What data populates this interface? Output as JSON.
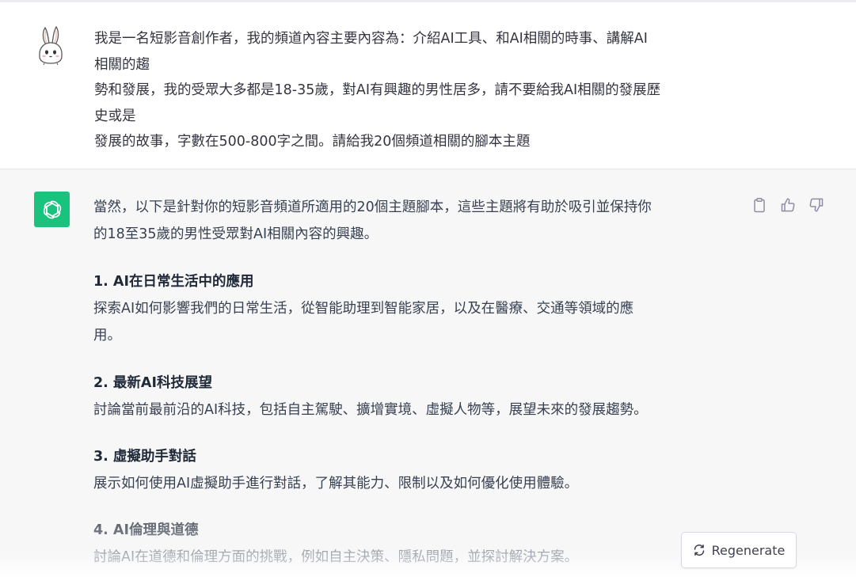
{
  "user": {
    "avatar_icon": "rabbit-avatar-icon",
    "lines": [
      "我是一名短影音創作者，我的頻道內容主要內容為：介紹AI工具、和AI相關的時事、講解AI",
      "相關的趨",
      "勢和發展，我的受眾大多都是18-35歲，對AI有興趣的男性居多，請不要給我AI相關的發展歷",
      "史或是",
      "發展的故事，字數在500-800字之間。請給我20個頻道相關的腳本主題"
    ]
  },
  "assistant": {
    "icon": "openai-logo-icon",
    "intro_lines": [
      "當然，以下是針對你的短影音頻道所適用的20個主題腳本，這些主題將有助於吸引並保持你",
      "的18至35歲的男性受眾對AI相關內容的興趣。"
    ],
    "topics": [
      {
        "title": "1. AI在日常生活中的應用",
        "lines": [
          "探索AI如何影響我們的日常生活，從智能助理到智能家居，以及在醫療、交通等領域的應",
          "用。"
        ]
      },
      {
        "title": "2. 最新AI科技展望",
        "lines": [
          "討論當前最前沿的AI科技，包括自主駕駛、擴增實境、虛擬人物等，展望未來的發展趨勢。"
        ]
      },
      {
        "title": "3. 虛擬助手對話",
        "lines": [
          "展示如何使用AI虛擬助手進行對話，了解其能力、限制以及如何優化使用體驗。"
        ]
      },
      {
        "title": "4. AI倫理與道德",
        "lines": [
          "討論AI在道德和倫理方面的挑戰，例如自主決策、隱私問題，並探討解決方案。"
        ]
      }
    ]
  },
  "actions": {
    "copy_icon": "clipboard-icon",
    "like_icon": "thumbs-up-icon",
    "dislike_icon": "thumbs-down-icon"
  },
  "regenerate": {
    "label": "Regenerate",
    "icon": "refresh-icon"
  }
}
